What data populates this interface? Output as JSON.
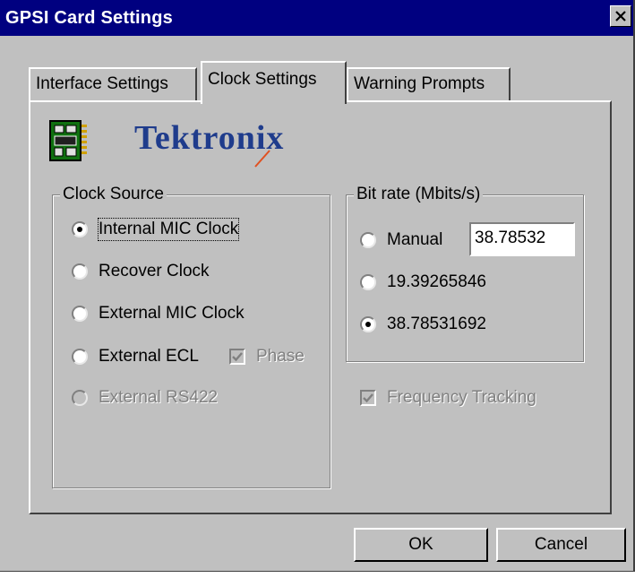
{
  "window": {
    "title": "GPSI Card Settings",
    "close_icon": "close-icon"
  },
  "tabs": [
    {
      "label": "Interface Settings",
      "active": false
    },
    {
      "label": "Clock Settings",
      "active": true
    },
    {
      "label": "Warning Prompts",
      "active": false
    }
  ],
  "logo": {
    "text": "Tektronix",
    "icon": "circuit-board-icon",
    "accent": "#e05020"
  },
  "clock_source": {
    "legend": "Clock Source",
    "options": [
      {
        "label": "Internal MIC Clock",
        "checked": true,
        "enabled": true
      },
      {
        "label": "Recover Clock",
        "checked": false,
        "enabled": true
      },
      {
        "label": "External MIC Clock",
        "checked": false,
        "enabled": true
      },
      {
        "label": "External ECL",
        "checked": false,
        "enabled": true
      },
      {
        "label": "External RS422",
        "checked": false,
        "enabled": false
      }
    ],
    "phase": {
      "label": "Phase",
      "checked": true,
      "enabled": false
    }
  },
  "bit_rate": {
    "legend": "Bit rate (Mbits/s)",
    "manual_label": "Manual",
    "manual_value": "38.78532",
    "options": [
      {
        "label": "Manual",
        "checked": false
      },
      {
        "label": "19.39265846",
        "checked": false
      },
      {
        "label": "38.78531692",
        "checked": true
      }
    ]
  },
  "frequency_tracking": {
    "label": "Frequency Tracking",
    "checked": true,
    "enabled": false
  },
  "buttons": {
    "ok": "OK",
    "cancel": "Cancel"
  },
  "colors": {
    "face": "#c0c0c0",
    "titlebar": "#000080",
    "logo_text": "#1f3c8c"
  }
}
